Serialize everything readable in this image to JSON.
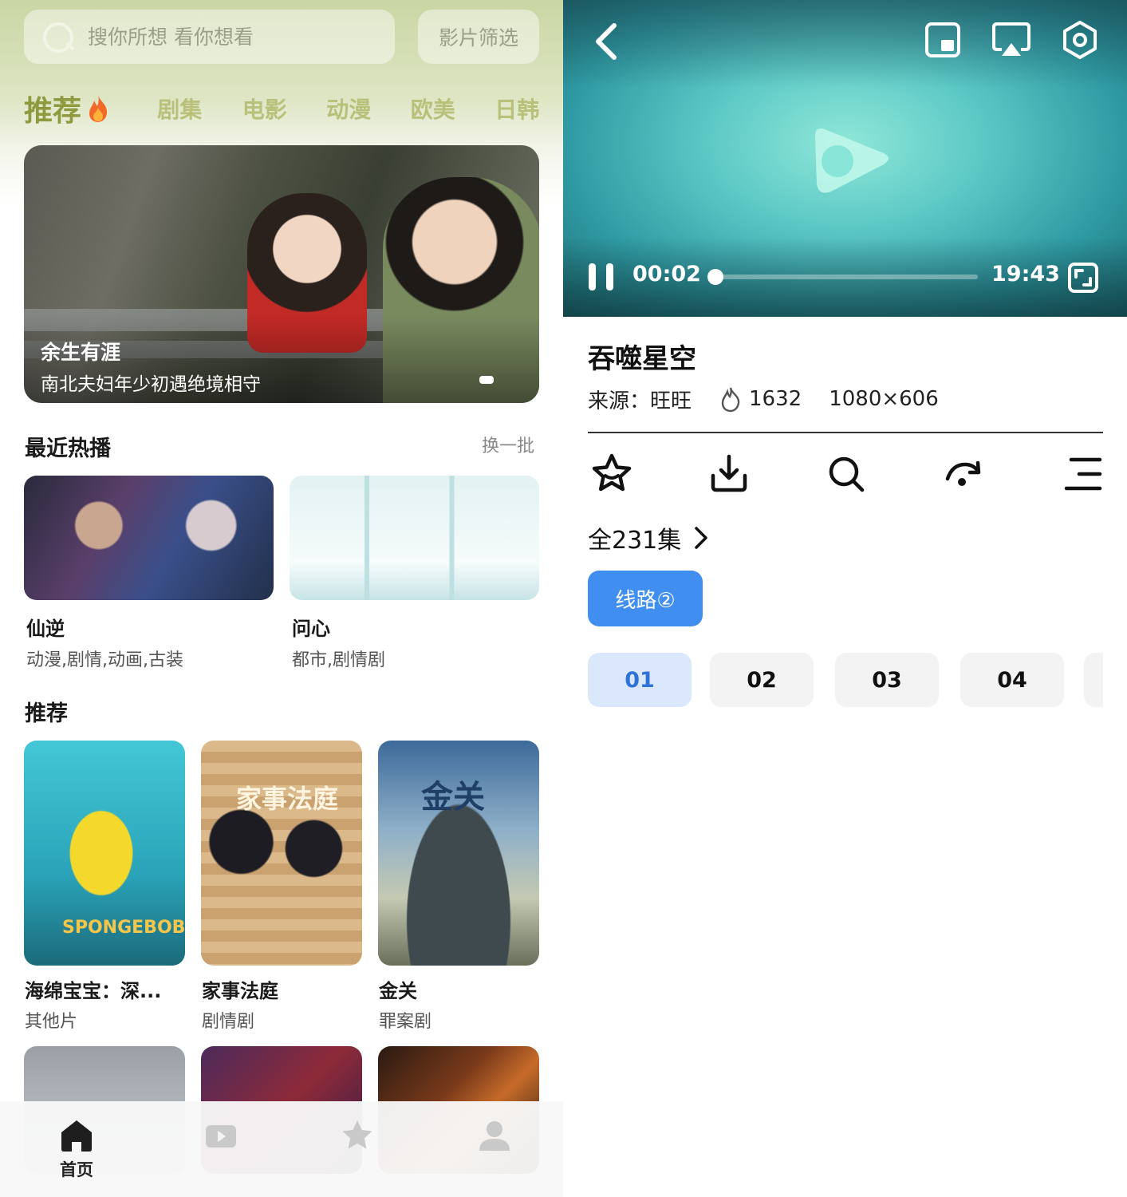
{
  "left": {
    "search": {
      "placeholder": "搜你所想 看你想看"
    },
    "filter_button": "影片筛选",
    "tabs": [
      {
        "label": "推荐"
      },
      {
        "label": "剧集"
      },
      {
        "label": "电影"
      },
      {
        "label": "动漫"
      },
      {
        "label": "欧美"
      },
      {
        "label": "日韩"
      }
    ],
    "banner": {
      "title": "余生有涯",
      "subtitle": "南北夫妇年少初遇绝境相守"
    },
    "recent": {
      "title": "最近热播",
      "more": "换一批",
      "items": [
        {
          "title": "仙逆",
          "tags": "动漫,剧情,动画,古装"
        },
        {
          "title": "问心",
          "tags": "都市,剧情剧"
        }
      ]
    },
    "recommend": {
      "title": "推荐",
      "items": [
        {
          "title": "海绵宝宝：深...",
          "tags": "其他片",
          "poster_text": "SPONGEBOB"
        },
        {
          "title": "家事法庭",
          "tags": "剧情剧",
          "poster_text": "家事法庭"
        },
        {
          "title": "金关",
          "tags": "罪案剧",
          "poster_text": "金关"
        }
      ]
    },
    "bottom_nav": [
      {
        "label": "首页",
        "icon": "home-icon",
        "active": true
      },
      {
        "label": "",
        "icon": "video-icon"
      },
      {
        "label": "",
        "icon": "star-icon"
      },
      {
        "label": "",
        "icon": "user-icon"
      }
    ]
  },
  "right": {
    "player": {
      "current_time": "00:02",
      "duration": "19:43",
      "progress": 0.002
    },
    "video": {
      "title": "吞噬星空",
      "source": "来源：旺旺",
      "views": "1632",
      "resolution": "1080×606"
    },
    "episodes_label": "全231集",
    "route_label": "线路②",
    "episodes": [
      "01",
      "02",
      "03",
      "04"
    ],
    "active_episode": "01",
    "colors": {
      "accent": "#3f8ef0",
      "active_episode_bg": "#dbe8fb"
    }
  }
}
